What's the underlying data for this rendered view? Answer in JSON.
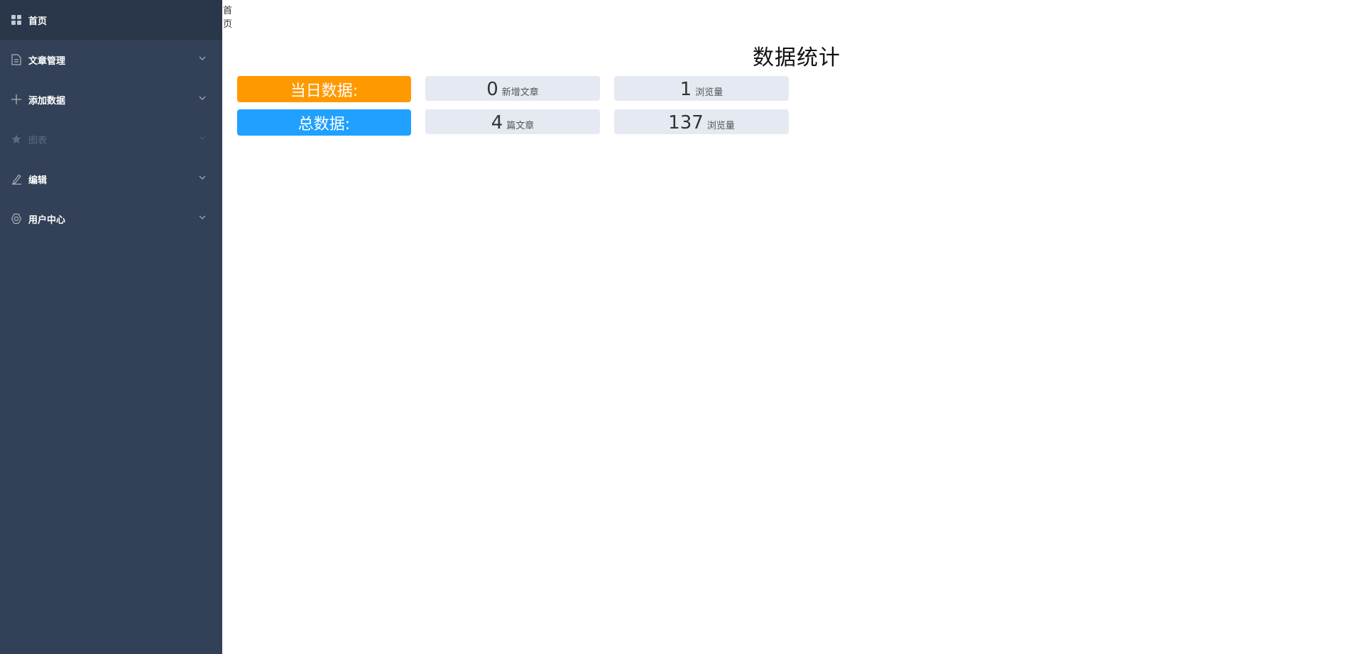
{
  "sidebar": {
    "items": [
      {
        "label": "首页",
        "icon": "grid-icon",
        "active": true,
        "has_submenu": false
      },
      {
        "label": "文章管理",
        "icon": "document-icon",
        "active": false,
        "has_submenu": true
      },
      {
        "label": "添加数据",
        "icon": "plus-icon",
        "active": false,
        "has_submenu": true
      },
      {
        "label": "图表",
        "icon": "star-icon",
        "active": false,
        "disabled": true,
        "has_submenu": true
      },
      {
        "label": "编辑",
        "icon": "edit-icon",
        "active": false,
        "has_submenu": true
      },
      {
        "label": "用户中心",
        "icon": "settings-icon",
        "active": false,
        "has_submenu": true
      }
    ]
  },
  "breadcrumb": "首页",
  "main": {
    "title": "数据统计",
    "today": {
      "label": "当日数据:",
      "new_articles": {
        "value": "0",
        "unit": "新增文章"
      },
      "views": {
        "value": "1",
        "unit": "浏览量"
      }
    },
    "total": {
      "label": "总数据:",
      "articles": {
        "value": "4",
        "unit": "篇文章"
      },
      "views": {
        "value": "137",
        "unit": "浏览量"
      }
    }
  },
  "colors": {
    "sidebar_bg": "#324157",
    "sidebar_active_bg": "#2a3649",
    "today_accent": "#ff9900",
    "total_accent": "#20a0ff",
    "stat_card_bg": "#e5e9f2"
  }
}
